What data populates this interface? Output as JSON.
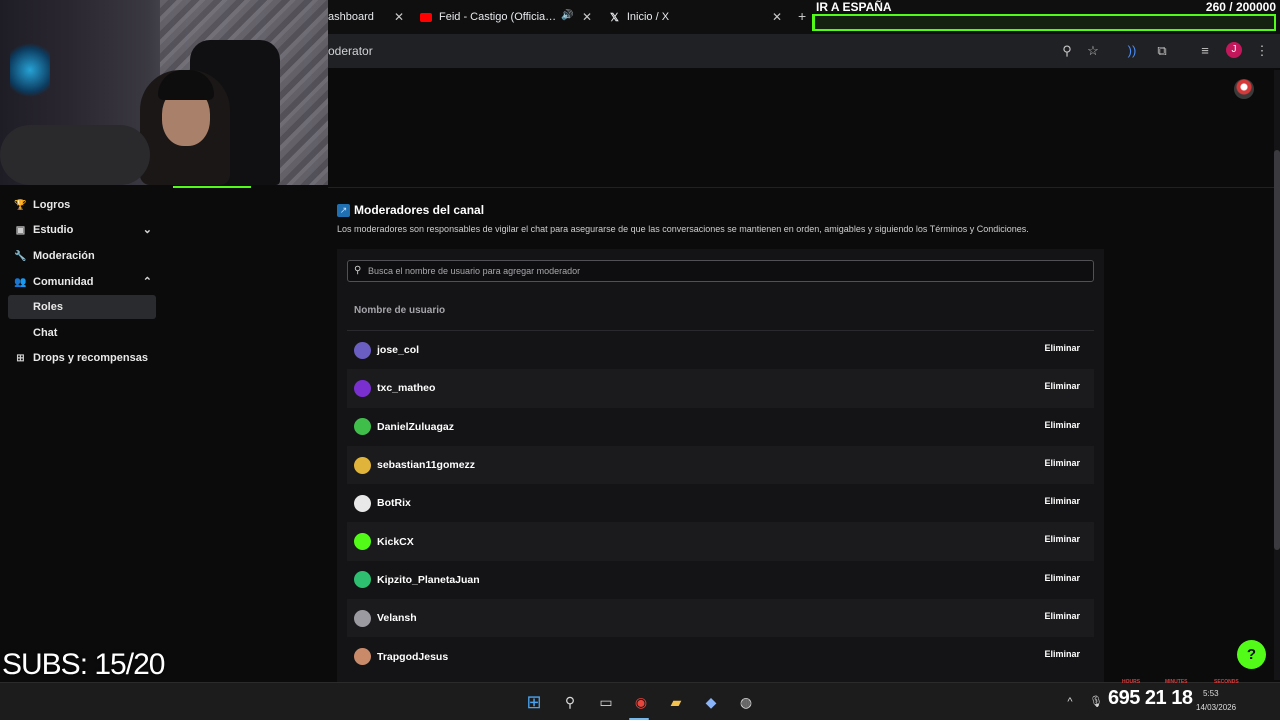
{
  "browser": {
    "tabs": [
      {
        "label": "ashboard"
      },
      {
        "label": "Feid - Castigo (Official Vide"
      },
      {
        "label": "Inicio / X"
      }
    ],
    "new_tab_icon": "plus-icon",
    "url_fragment": "oderator"
  },
  "overlay": {
    "goal_title": "IR A ESPAÑA",
    "goal_count": "260 / 200000",
    "goal_progress": 0.0013,
    "subs": "SUBS: 15/20",
    "timer": "695 21 18",
    "timer_units": [
      "HOURS",
      "MINUTES",
      "SECONDS"
    ]
  },
  "sidebar": {
    "items": [
      {
        "label": "Logros",
        "icon": "trophy-icon"
      },
      {
        "label": "Estudio",
        "icon": "video-icon"
      },
      {
        "label": "Moderación",
        "icon": "wrench-icon"
      },
      {
        "label": "Comunidad",
        "icon": "people-icon"
      },
      {
        "label": "Roles"
      },
      {
        "label": "Chat"
      },
      {
        "label": "Drops y recompensas",
        "icon": "gift-icon"
      }
    ]
  },
  "main": {
    "title": "Moderadores del canal",
    "description": "Los moderadores son responsables de vigilar el chat para asegurarse de que las conversaciones se mantienen en orden, amigables y siguiendo los Términos y Condiciones.",
    "search_placeholder": "Busca el nombre de usuario para agregar moderador",
    "column_header": "Nombre de usuario",
    "remove_label": "Eliminar",
    "moderators": [
      {
        "name": "jose_col",
        "avatar_color": "#6b5ec2"
      },
      {
        "name": "txc_matheo",
        "avatar_color": "#7a2fd1"
      },
      {
        "name": "DanielZuluagaz",
        "avatar_color": "#3fbf4a"
      },
      {
        "name": "sebastian11gomezz",
        "avatar_color": "#e0b33a"
      },
      {
        "name": "BotRix",
        "avatar_color": "#e8e8e8"
      },
      {
        "name": "KickCX",
        "avatar_color": "#53fc18"
      },
      {
        "name": "Kipzito_PlanetaJuan",
        "avatar_color": "#2fbf71"
      },
      {
        "name": "Velansh",
        "avatar_color": "#9a9aa0"
      },
      {
        "name": "TrapgodJesus",
        "avatar_color": "#c98a6a"
      }
    ]
  },
  "taskbar": {
    "clock_time": "5:53",
    "clock_date": "14/03/2026"
  },
  "colors": {
    "accent": "#53fc18",
    "background": "#0b0b0c",
    "panel": "#141416"
  }
}
